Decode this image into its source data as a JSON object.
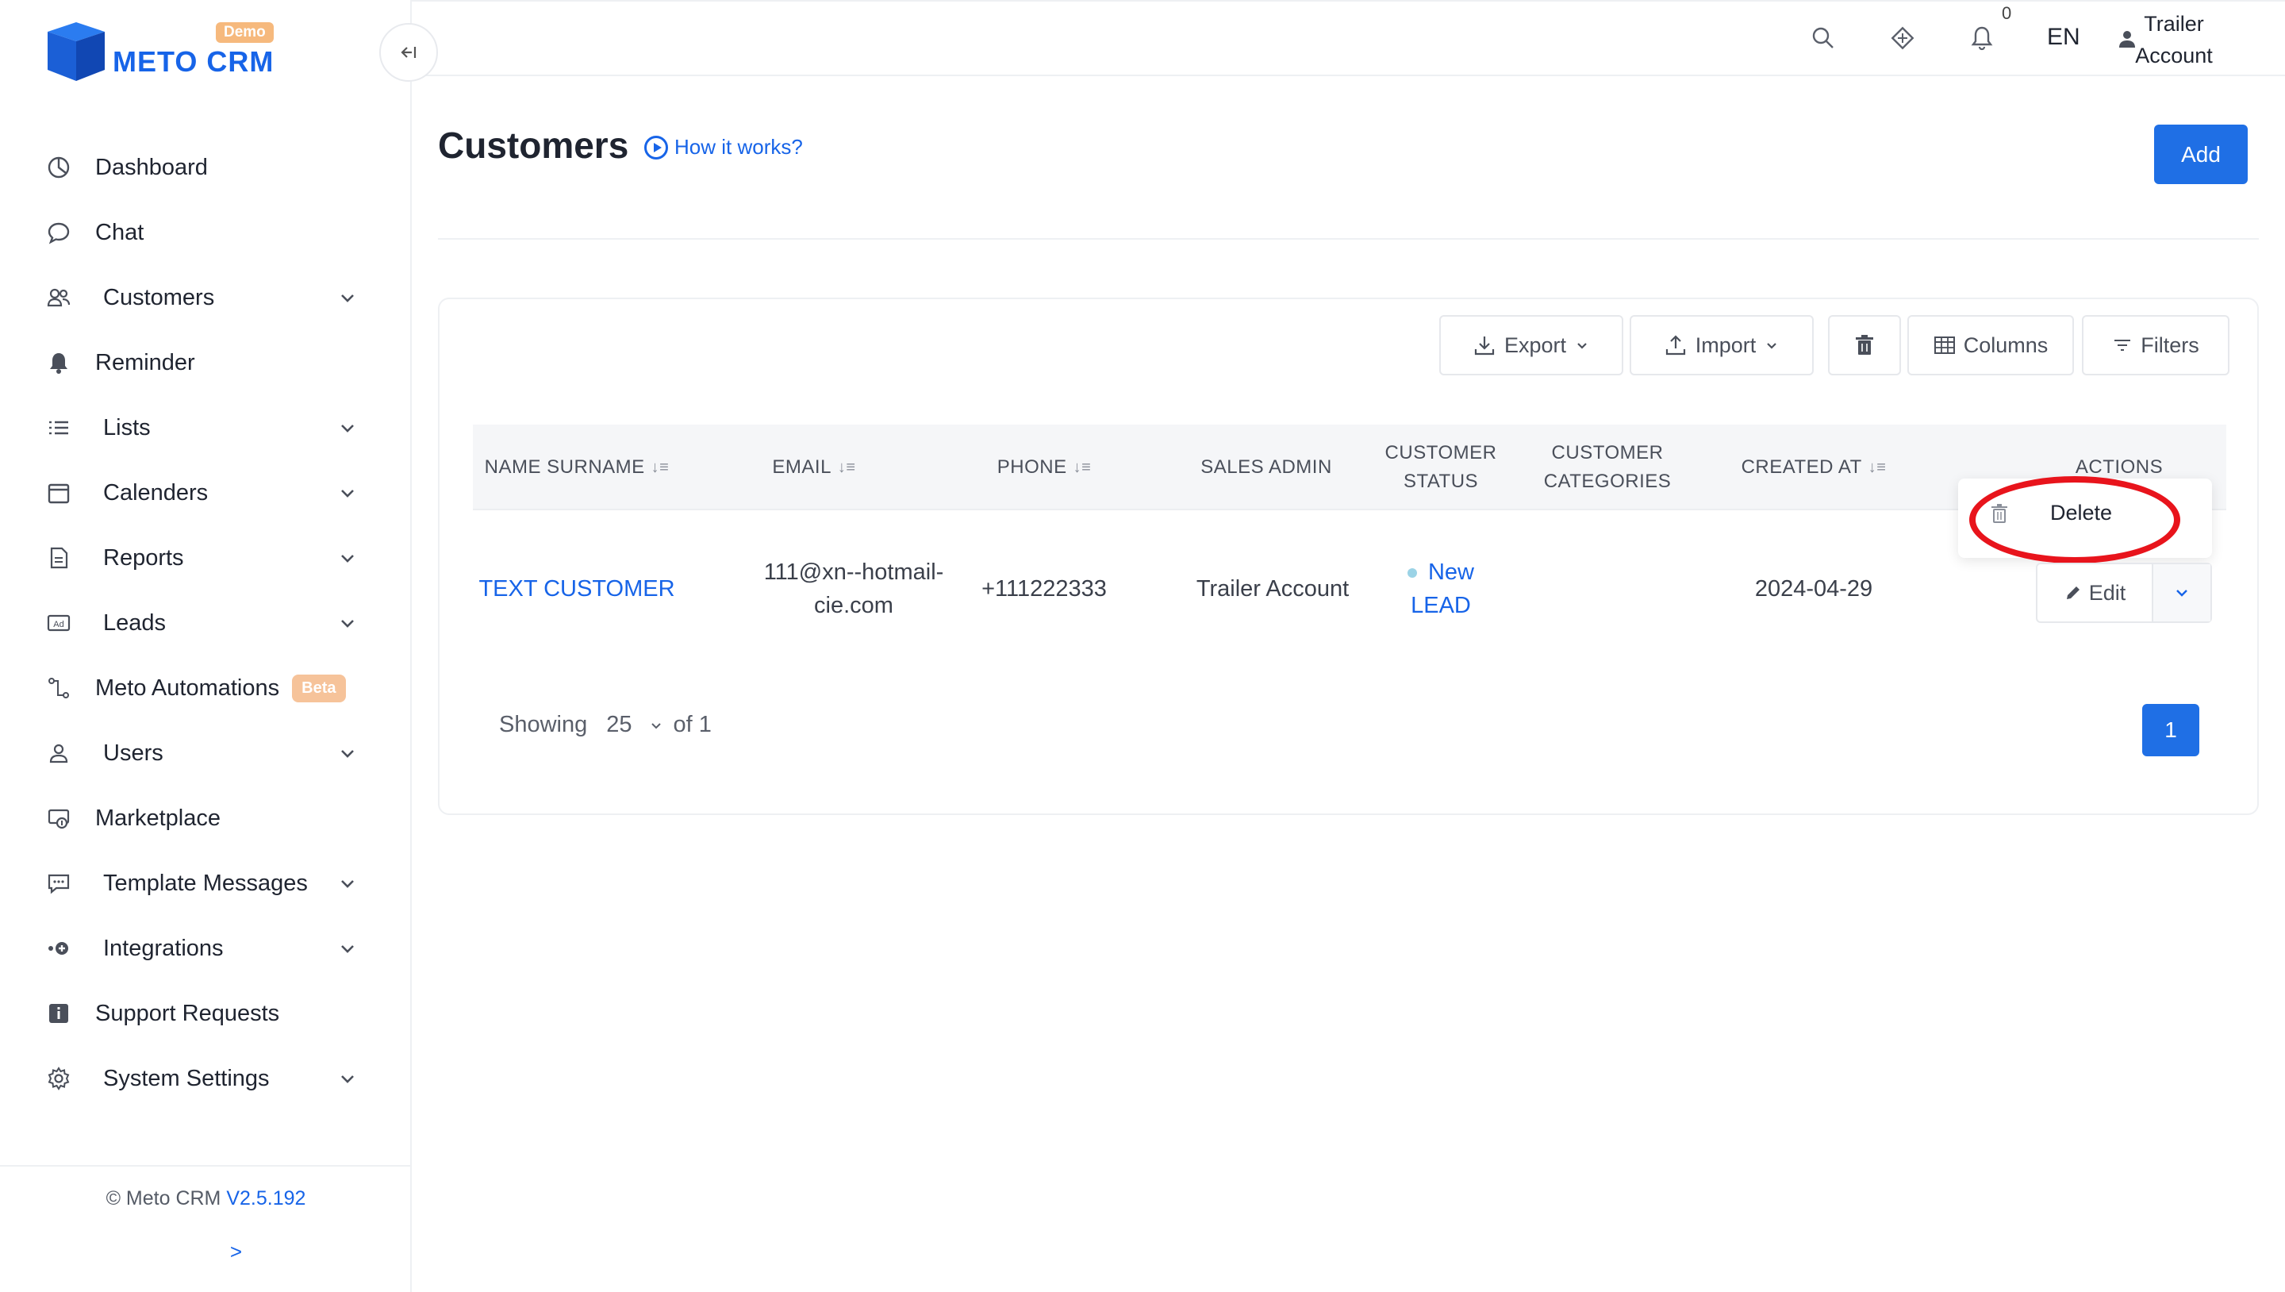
{
  "brand": {
    "name": "METO CRM",
    "badge": "Demo",
    "accent_color": "#1764e8"
  },
  "sidebar": {
    "items": [
      {
        "label": "Dashboard",
        "icon": "dashboard-icon"
      },
      {
        "label": "Chat",
        "icon": "chat-icon"
      },
      {
        "label": "Customers",
        "icon": "customers-icon",
        "expandable": true
      },
      {
        "label": "Reminder",
        "icon": "bell-icon"
      },
      {
        "label": "Lists",
        "icon": "list-icon",
        "expandable": true
      },
      {
        "label": "Calenders",
        "icon": "calendar-icon",
        "expandable": true
      },
      {
        "label": "Reports",
        "icon": "report-icon",
        "expandable": true
      },
      {
        "label": "Leads",
        "icon": "ad-icon",
        "expandable": true
      },
      {
        "label": "Meto Automations",
        "icon": "automation-icon",
        "badge": "Beta"
      },
      {
        "label": "Users",
        "icon": "user-icon",
        "expandable": true
      },
      {
        "label": "Marketplace",
        "icon": "marketplace-icon"
      },
      {
        "label": "Template Messages",
        "icon": "message-template-icon",
        "expandable": true
      },
      {
        "label": "Integrations",
        "icon": "integration-icon",
        "expandable": true
      },
      {
        "label": "Support Requests",
        "icon": "info-icon"
      },
      {
        "label": "System Settings",
        "icon": "gear-icon",
        "expandable": true
      }
    ],
    "footer": {
      "copyright": "© Meto CRM",
      "version": "V2.5.192",
      "expand": ">"
    }
  },
  "topbar": {
    "notification_count": "0",
    "language": "EN",
    "account_line1": "Trailer",
    "account_line2": "Account"
  },
  "page": {
    "title": "Customers",
    "help_link": "How it works?",
    "add_label": "Add"
  },
  "toolbar": {
    "export": "Export",
    "import": "Import",
    "columns": "Columns",
    "filters": "Filters"
  },
  "table": {
    "headers": {
      "name": "NAME SURNAME",
      "email": "EMAIL",
      "phone": "PHONE",
      "sales_admin": "SALES ADMIN",
      "status_1": "CUSTOMER",
      "status_2": "STATUS",
      "categories_1": "CUSTOMER",
      "categories_2": "CATEGORIES",
      "created_at": "CREATED AT",
      "actions": "ACTIONS"
    },
    "rows": [
      {
        "name": "TEXT CUSTOMER",
        "email_1": "111@xn--hotmail-",
        "email_2": "cie.com",
        "phone": "+111222333",
        "sales_admin": "Trailer Account",
        "status_1": "New",
        "status_2": "LEAD",
        "categories": "",
        "created_at": "2024-04-29",
        "edit_label": "Edit"
      }
    ],
    "row_menu": {
      "delete_label": "Delete"
    }
  },
  "pagination": {
    "showing": "Showing",
    "page_size": "25",
    "of_label": "of 1",
    "current_page": "1"
  },
  "colors": {
    "primary": "#1f6fe5",
    "highlight": "#e8141c",
    "status_dot": "#9bd3e6",
    "beta_badge": "#f6c39a",
    "demo_badge": "#f6b97d"
  }
}
